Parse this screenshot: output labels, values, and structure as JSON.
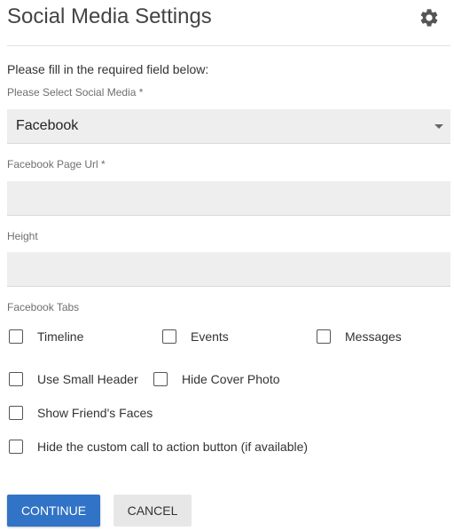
{
  "header": {
    "title": "Social Media Settings",
    "settings_icon": "gear-icon"
  },
  "form": {
    "intro": "Please fill in the required field below:",
    "social_media": {
      "label": "Please Select Social Media *",
      "selected": "Facebook"
    },
    "page_url": {
      "label": "Facebook Page Url *",
      "value": ""
    },
    "height": {
      "label": "Height",
      "value": ""
    },
    "tabs": {
      "label": "Facebook Tabs",
      "timeline": "Timeline",
      "events": "Events",
      "messages": "Messages"
    },
    "options": {
      "use_small_header": "Use Small Header",
      "hide_cover_photo": "Hide Cover Photo",
      "show_friends_faces": "Show Friend's Faces",
      "hide_cta": "Hide the custom call to action button (if available)"
    }
  },
  "actions": {
    "continue": "CONTINUE",
    "cancel": "CANCEL"
  },
  "colors": {
    "primary": "#3173c6",
    "field_bg": "#eeeeee",
    "secondary_button": "#e7e7e7"
  }
}
